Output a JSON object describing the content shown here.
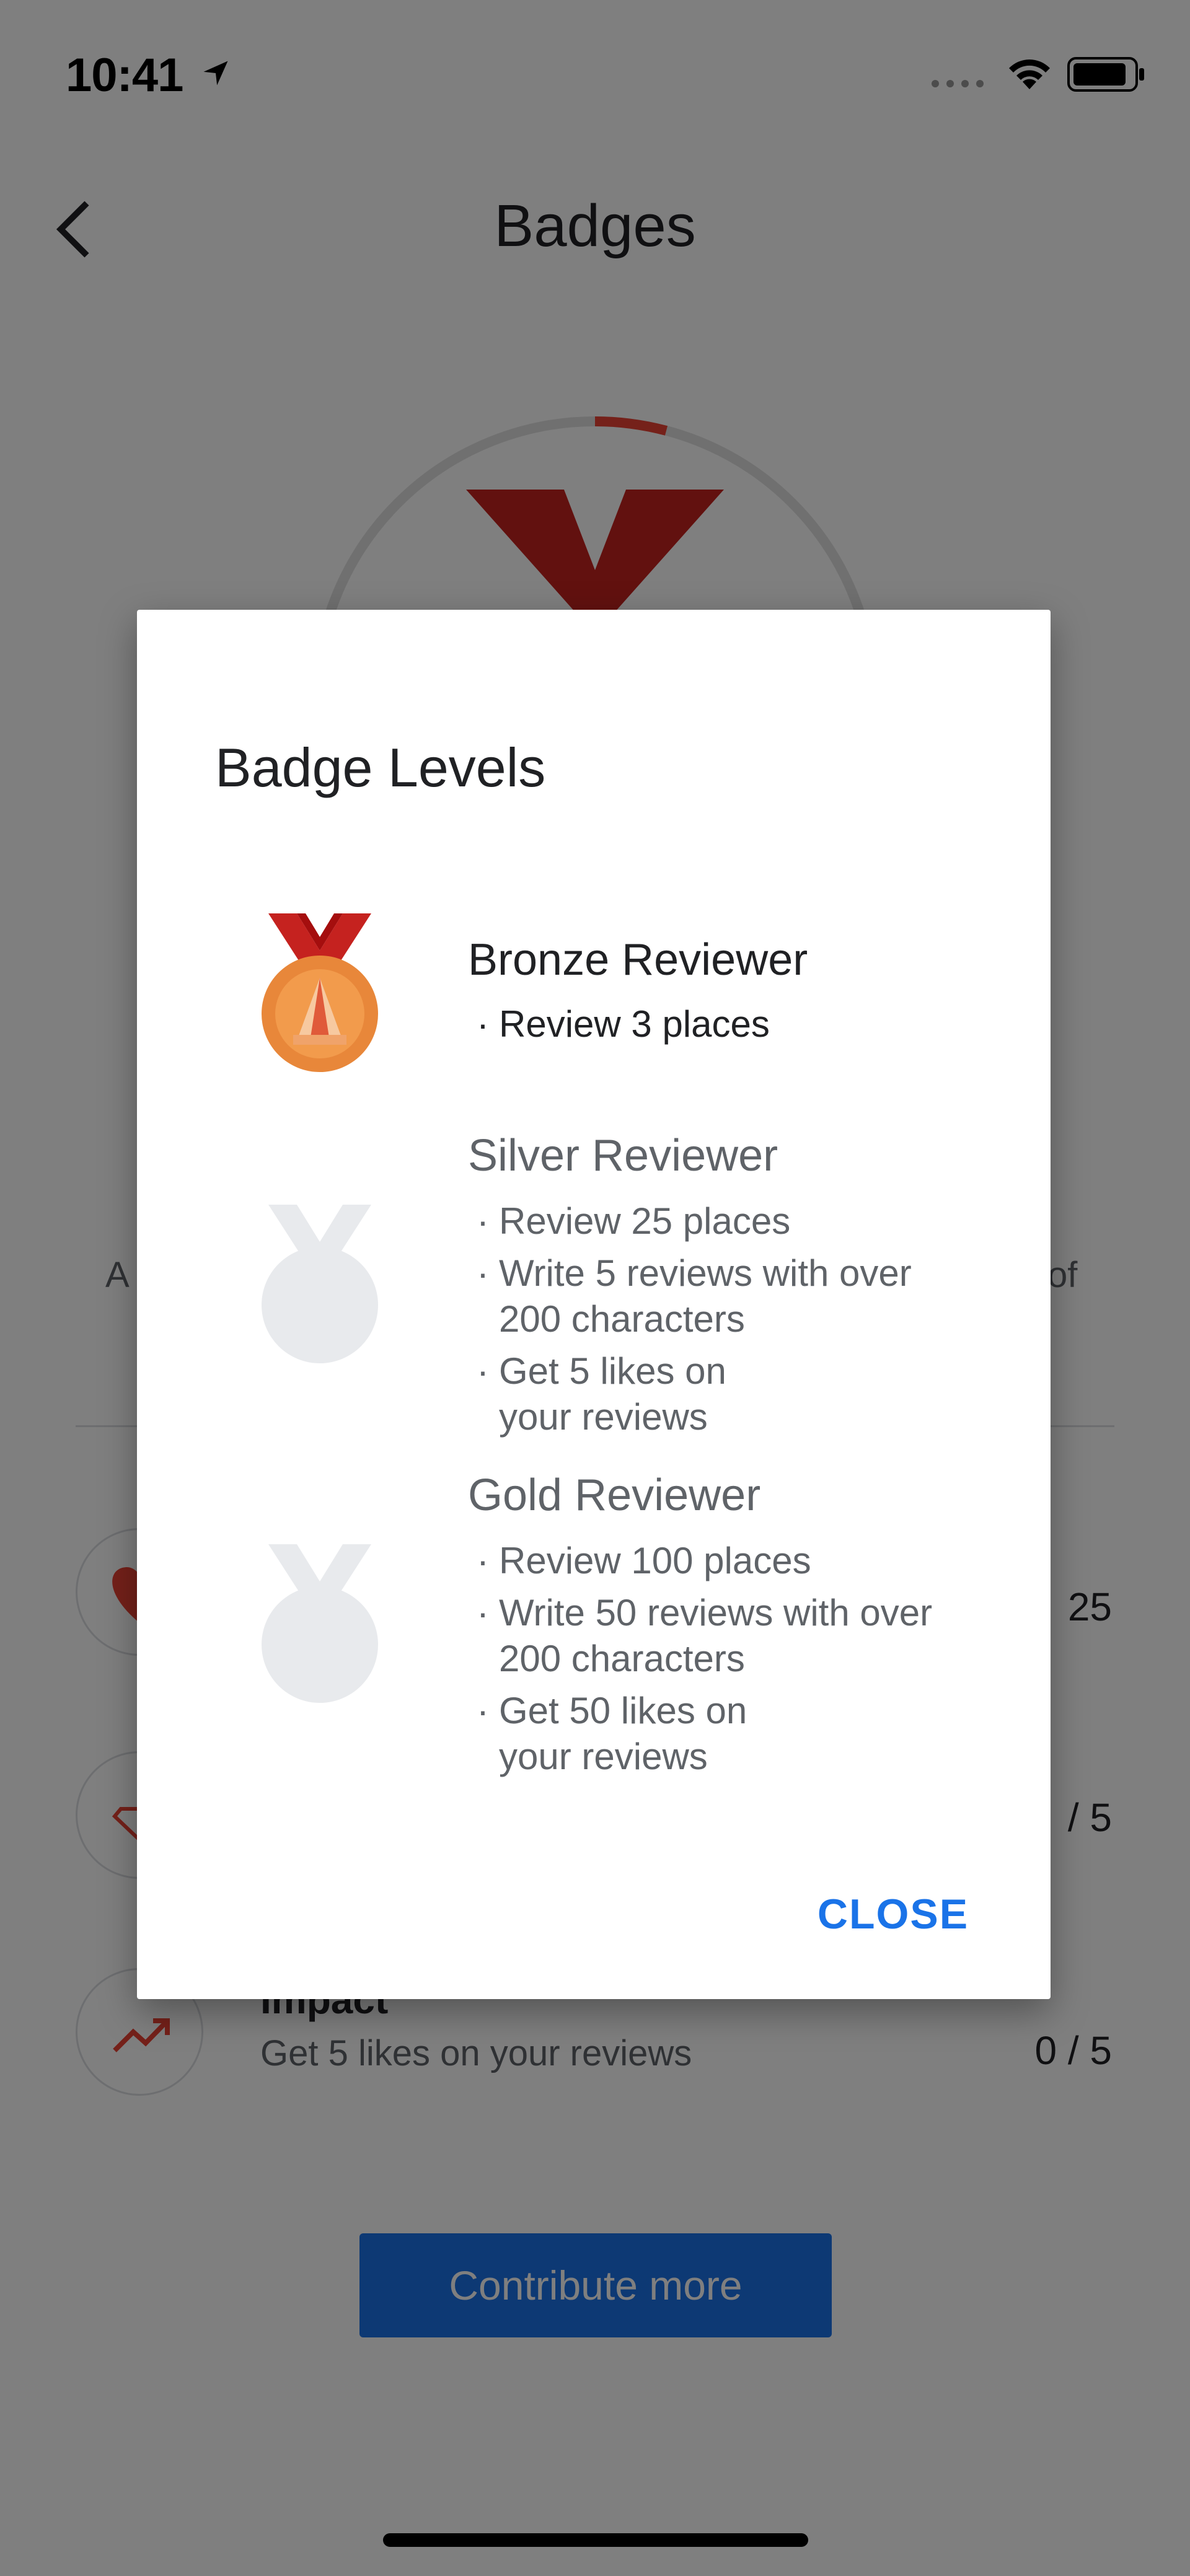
{
  "status_bar": {
    "time": "10:41"
  },
  "header": {
    "title": "Badges"
  },
  "background": {
    "available_prefix": "A",
    "available_suffix": "of",
    "criteria": [
      {
        "title": "",
        "description": "",
        "count": "25",
        "color": "#ea4335"
      },
      {
        "title": "",
        "description": "",
        "count": "/ 5",
        "color": "#ea4335"
      },
      {
        "title": "Impact",
        "description": "Get 5 likes on your reviews",
        "count": "0 / 5",
        "color": "#ea4335"
      }
    ],
    "contribute_button": "Contribute more"
  },
  "dialog": {
    "title": "Badge Levels",
    "levels": [
      {
        "name": "Bronze Reviewer",
        "earned": true,
        "requirements": [
          "Review 3 places"
        ]
      },
      {
        "name": "Silver Reviewer",
        "earned": false,
        "requirements": [
          "Review 25 places",
          "Write 5 reviews with over\n200 characters",
          "Get 5 likes on\nyour reviews"
        ]
      },
      {
        "name": "Gold Reviewer",
        "earned": false,
        "requirements": [
          "Review 100 places",
          "Write 50 reviews with over\n200 characters",
          "Get 50 likes on\nyour reviews"
        ]
      }
    ],
    "bullet": "·",
    "close_label": "CLOSE"
  },
  "colors": {
    "accent": "#1a73e8",
    "bronze": "#e8873a",
    "ribbon": "#c5221f",
    "locked_medal": "#e8eaed"
  }
}
